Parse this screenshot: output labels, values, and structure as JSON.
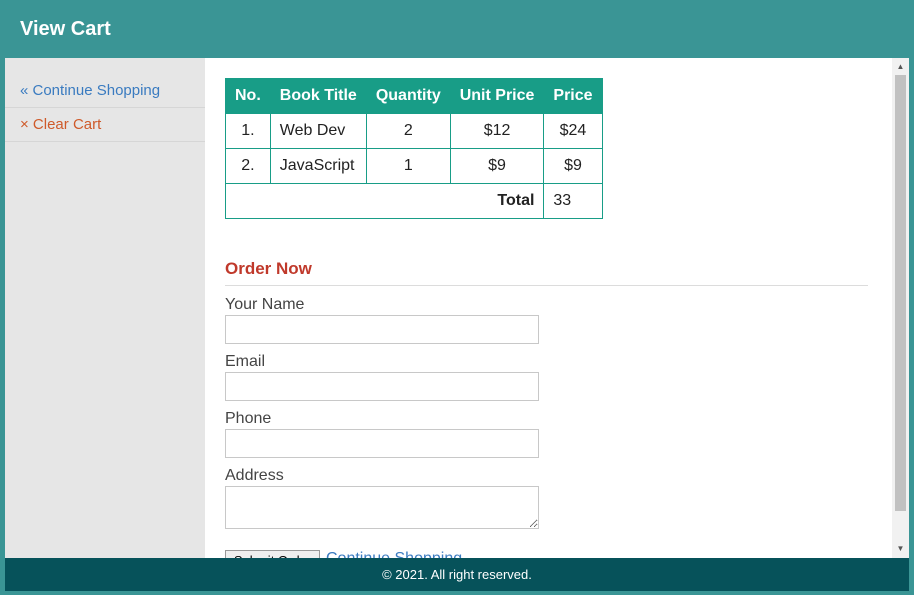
{
  "header": {
    "title": "View Cart"
  },
  "sidebar": {
    "items": [
      {
        "label": "« Continue Shopping",
        "color": "#3a7bc0"
      },
      {
        "label": "× Clear Cart",
        "color": "#cf5a2a"
      }
    ]
  },
  "cart": {
    "columns": [
      "No.",
      "Book Title",
      "Quantity",
      "Unit Price",
      "Price"
    ],
    "rows": [
      {
        "no": "1.",
        "title": "Web Dev",
        "qty": "2",
        "unit": "$12",
        "price": "$24"
      },
      {
        "no": "2.",
        "title": "JavaScript",
        "qty": "1",
        "unit": "$9",
        "price": "$9"
      }
    ],
    "total_label": "Total",
    "total_value": "33",
    "header_color": "#189d87"
  },
  "order": {
    "title": "Order Now",
    "fields": {
      "name_label": "Your Name",
      "email_label": "Email",
      "phone_label": "Phone",
      "address_label": "Address"
    },
    "submit_label": "Submit Order",
    "continue_label": "Continue Shopping"
  },
  "footer": {
    "text": "© 2021. All right reserved."
  },
  "colors": {
    "accent": "#3a9595",
    "footer": "#06525a",
    "order_title": "#c0392b"
  }
}
